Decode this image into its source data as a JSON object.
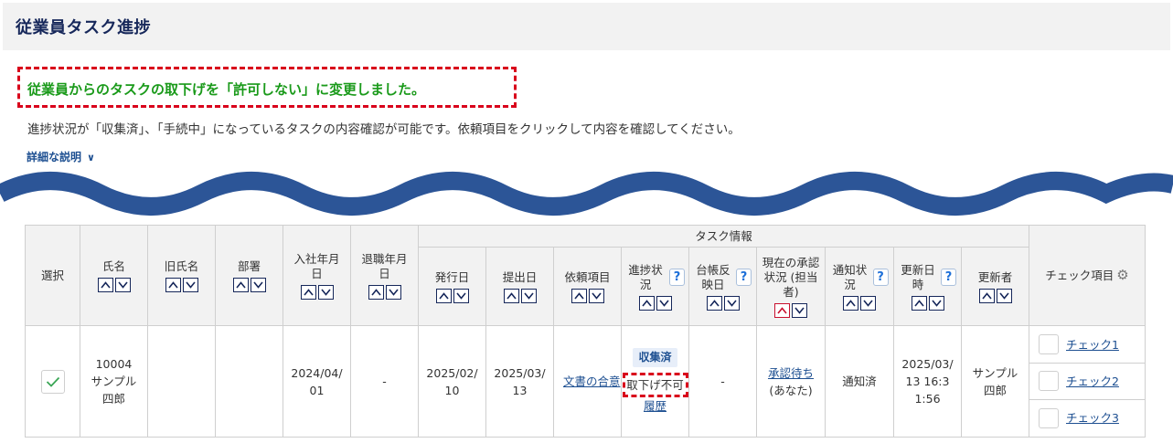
{
  "page": {
    "title": "従業員タスク進捗",
    "notice": "従業員からのタスクの取下げを「許可しない」に変更しました。",
    "description": "進捗状況が「収集済」、「手続中」になっているタスクの内容確認が可能です。依頼項目をクリックして内容を確認してください。",
    "detail_link": "詳細な説明"
  },
  "table": {
    "group_header": "タスク情報",
    "headers": {
      "select": "選択",
      "name": "氏名",
      "old_name": "旧氏名",
      "department": "部署",
      "hire_date": "入社年月日",
      "retire_date": "退職年月日",
      "issue_date": "発行日",
      "submit_date": "提出日",
      "request_item": "依頼項目",
      "progress": "進捗状況",
      "ledger_date": "台帳反映日",
      "approval_status": "現在の承認状況 (担当者)",
      "notify_status": "通知状況",
      "updated_at": "更新日時",
      "updated_by": "更新者",
      "check_items": "チェック項目"
    },
    "row": {
      "employee_id": "10004",
      "employee_name": "サンプル四郎",
      "old_name": "",
      "department": "",
      "hire_date": "2024/04/01",
      "retire_date": "-",
      "issue_date": "2025/02/10",
      "submit_date": "2025/03/13",
      "request_item": "文書の合意",
      "progress_badge": "収集済",
      "progress_note": "取下げ不可",
      "history_link": "履歴",
      "ledger_date": "-",
      "approval_link": "承認待ち",
      "approval_person": "(あなた)",
      "notify_status": "通知済",
      "updated_at": "2025/03/13 16:31:56",
      "updated_by": "サンプル四郎",
      "checks": [
        "チェック1",
        "チェック2",
        "チェック3"
      ]
    }
  },
  "colors": {
    "title": "#16275a",
    "notice_text": "#1a9a1a",
    "notice_border": "#d9001b",
    "wave": "#2c5597",
    "link": "#1d4f91"
  }
}
